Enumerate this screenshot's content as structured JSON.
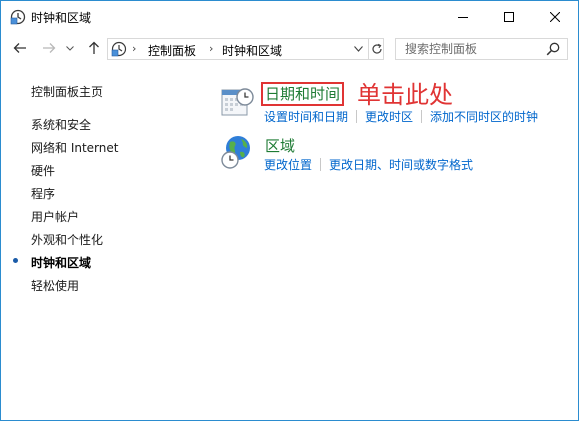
{
  "window": {
    "title": "时钟和区域",
    "controls": [
      "minimize",
      "maximize",
      "close"
    ]
  },
  "nav": {
    "breadcrumb": [
      "控制面板",
      "时钟和区域"
    ],
    "search_placeholder": "搜索控制面板"
  },
  "sidebar": {
    "home": "控制面板主页",
    "items": [
      {
        "label": "系统和安全",
        "active": false
      },
      {
        "label": "网络和 Internet",
        "active": false
      },
      {
        "label": "硬件",
        "active": false
      },
      {
        "label": "程序",
        "active": false
      },
      {
        "label": "用户帐户",
        "active": false
      },
      {
        "label": "外观和个性化",
        "active": false
      },
      {
        "label": "时钟和区域",
        "active": true
      },
      {
        "label": "轻松使用",
        "active": false
      }
    ]
  },
  "main": {
    "categories": [
      {
        "title": "日期和时间",
        "icon": "calendar-clock-icon",
        "links": [
          "设置时间和日期",
          "更改时区",
          "添加不同时区的时钟"
        ]
      },
      {
        "title": "区域",
        "icon": "globe-clock-icon",
        "links": [
          "更改位置",
          "更改日期、时间或数字格式"
        ]
      }
    ],
    "annotation": "单击此处"
  },
  "colors": {
    "link": "#0066cc",
    "category_title": "#1e7b34",
    "highlight": "#e03434",
    "window_border": "#2b8ccf"
  }
}
